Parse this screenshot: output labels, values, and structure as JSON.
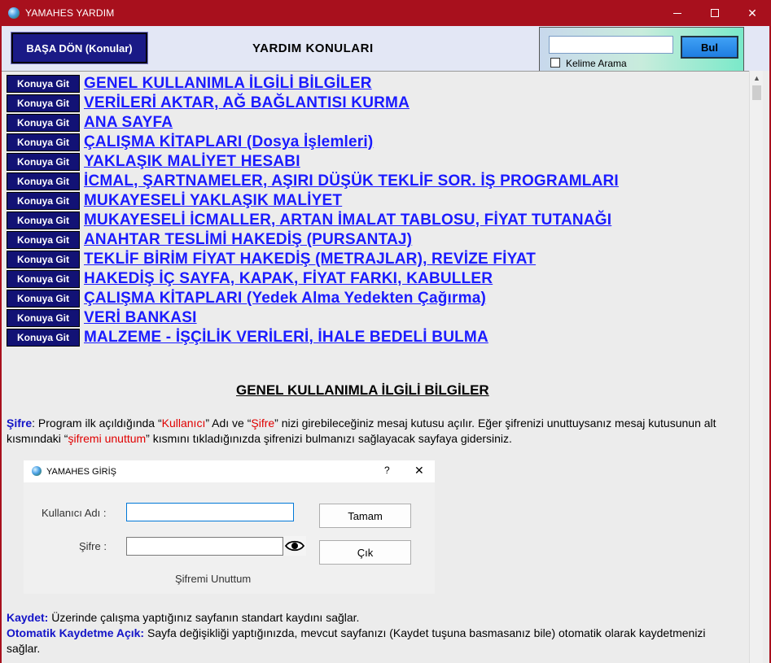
{
  "window": {
    "title": "YAMAHES  YARDIM",
    "min_glyph": "—",
    "max_glyph": "☐",
    "close_glyph": "✕"
  },
  "toolbar": {
    "back_label": "BAŞA DÖN (Konular)",
    "help_title": "YARDIM  KONULARI",
    "search_value": "",
    "find_label": "Bul",
    "word_search_label": "Kelime Arama",
    "word_search_checked": false
  },
  "topics": {
    "go_label": "Konuya Git",
    "items": [
      {
        "label": "GENEL KULLANIMLA İLGİLİ  BİLGİLER"
      },
      {
        "label": "VERİLERİ AKTAR, AĞ BAĞLANTISI KURMA"
      },
      {
        "label": "ANA SAYFA"
      },
      {
        "label": "ÇALIŞMA KİTAPLARI (Dosya İşlemleri)"
      },
      {
        "label": "YAKLAŞIK MALİYET HESABI"
      },
      {
        "label": "İCMAL, ŞARTNAMELER, AŞIRI DÜŞÜK TEKLİF SOR. İŞ PROGRAMLARI"
      },
      {
        "label": "MUKAYESELİ YAKLAŞIK MALİYET"
      },
      {
        "label": "MUKAYESELİ İCMALLER, ARTAN İMALAT TABLOSU, FİYAT TUTANAĞI"
      },
      {
        "label": "ANAHTAR TESLİMİ HAKEDİŞ (PURSANTAJ)"
      },
      {
        "label": "TEKLİF BİRİM FİYAT  HAKEDİŞ (METRAJLAR), REVİZE FİYAT"
      },
      {
        "label": "HAKEDİŞ İÇ SAYFA,  KAPAK,  FİYAT FARKI, KABULLER"
      },
      {
        "label": "ÇALIŞMA KİTAPLARI (Yedek Alma Yedekten Çağırma)"
      },
      {
        "label": "VERİ BANKASI"
      },
      {
        "label": "MALZEME - İŞÇİLİK VERİLERİ, İHALE BEDELİ BULMA"
      }
    ]
  },
  "section": {
    "heading": " GENEL KULLANIMLA İLGİLİ BİLGİLER",
    "sifre": {
      "kw": "Şifre",
      "t1": ": Program ilk açıldığında “",
      "r1": "Kullanıcı",
      "t2": "” Adı ve “",
      "r2": "Şifre",
      "t3": "” nizi girebileceğiniz mesaj kutusu açılır. Eğer şifrenizi unuttuysanız mesaj kutusunun alt kısmındaki “",
      "r3": "şifremi unuttum",
      "t4": "” kısmını tıkladığınızda şifrenizi bulmanızı sağlayacak sayfaya gidersiniz."
    },
    "kaydet": {
      "kw": "Kaydet:",
      "text": " Üzerinde çalışma yaptığınız sayfanın standart kaydını sağlar."
    },
    "otomatik": {
      "kw": "Otomatik Kaydetme Açık:",
      "text": " Sayfa değişikliği yaptığınızda, mevcut sayfanızı (Kaydet tuşuna basmasanız bile) otomatik olarak kaydetmenizi sağlar."
    }
  },
  "login_dialog": {
    "title": "YAMAHES GİRİŞ",
    "help_glyph": "?",
    "close_glyph": "✕",
    "username_label": "Kullanıcı Adı :",
    "password_label": "Şifre :",
    "username_value": "",
    "password_value": "",
    "ok_label": "Tamam",
    "exit_label": "Çık",
    "forgot_label": "Şifremi Unuttum"
  }
}
